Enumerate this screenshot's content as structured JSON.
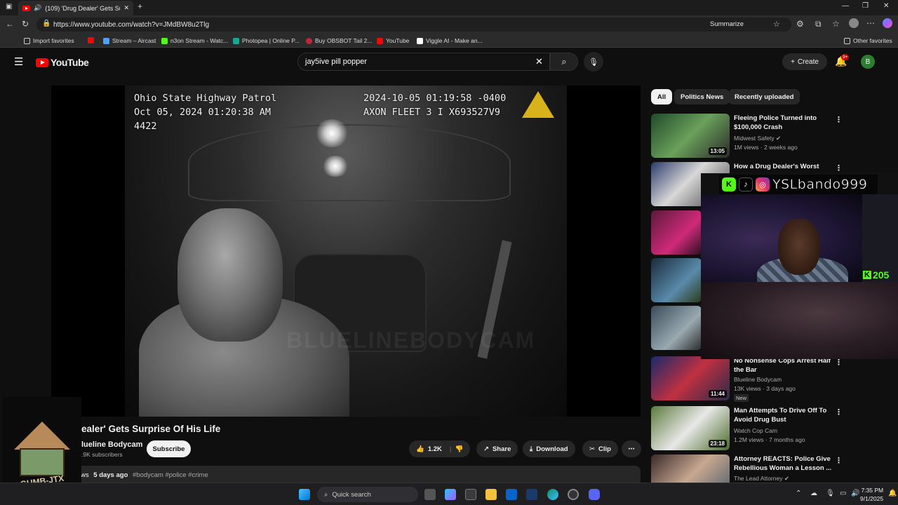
{
  "browser": {
    "tab_title": "(109) 'Drug Dealer' Gets Surp...",
    "url": "https://www.youtube.com/watch?v=JMdBW8u2Tlg",
    "summarize_label": "Summarize",
    "bookmarks": [
      "Import favorites",
      "Stream – Aircast",
      "n3on Stream - Watc...",
      "Photopea | Online P...",
      "Buy OBSBOT Tail 2...",
      "YouTube",
      "Viggle AI - Make an..."
    ],
    "other_favorites": "Other favorites"
  },
  "youtube": {
    "logo_text": "YouTube",
    "search_value": "jay5ive pill popper",
    "create_label": "Create",
    "notif_count": "9+",
    "avatar_letter": "B"
  },
  "video": {
    "osd_left": "Ohio State Highway Patrol\nOct 05, 2024 01:20:38 AM\n4422",
    "osd_right": "2024-10-05 01:19:58 -0400\nAXON FLEET 3 I X693527V9",
    "watermark": "BLUELINEBODYCAM",
    "title": "ealer' Gets Surprise Of His Life",
    "channel": "lueline Bodycam",
    "subscribers": ".9K subscribers",
    "subscribe_label": "Subscribe",
    "likes": "1.2K",
    "share_label": "Share",
    "download_label": "Download",
    "clip_label": "Clip",
    "desc_views": "ws",
    "desc_age": "5 days ago",
    "desc_tags": "#bodycam #police #crime"
  },
  "chips": [
    "All",
    "Politics News",
    "Recently uploaded"
  ],
  "recommendations": [
    {
      "title": "Fleeing Police Turned into $100,000 Crash",
      "channel": "Midwest Safety",
      "meta": "1M views · 2 weeks ago",
      "duration": "13:05",
      "verified": true
    },
    {
      "title": "How a Drug Dealer's Worst",
      "channel": "",
      "meta": "",
      "duration": "",
      "verified": false
    },
    {
      "title": "No Nonsense Cops Arrest Half the Bar",
      "channel": "Blueline Bodycam",
      "meta": "13K views · 3 days ago",
      "duration": "11:44",
      "badge": "New"
    },
    {
      "title": "Man Attempts To Drive Off To Avoid Drug Bust",
      "channel": "Watch Cop Cam",
      "meta": "1.2M views · 7 months ago",
      "duration": "23:18"
    },
    {
      "title": "Attorney REACTS: Police Give Rebellious Woman a Lesson ...",
      "channel": "The Lead Attorney",
      "meta": "",
      "duration": "",
      "verified": true
    }
  ],
  "stream_overlay": {
    "username": "YSLbando999",
    "kick_count": "205",
    "logo_text": "GUMB-JTX"
  },
  "taskbar": {
    "search_placeholder": "Quick search",
    "time": "7:35 PM",
    "date": "9/1/2025"
  }
}
